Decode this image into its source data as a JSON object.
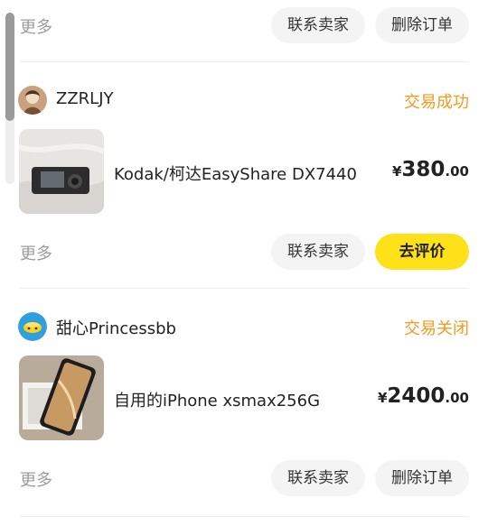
{
  "top_actions": {
    "more_label": "更多",
    "contact_label": "联系卖家",
    "delete_label": "删除订单"
  },
  "orders": [
    {
      "seller_name": "ZZRLJY",
      "status": "交易成功",
      "product_title": "Kodak/柯达EasyShare DX7440",
      "price_currency": "¥",
      "price_integer": "380",
      "price_decimal": ".00",
      "more_label": "更多",
      "contact_label": "联系卖家",
      "action_label": "去评价"
    },
    {
      "seller_name": "甜心Princessbb",
      "status": "交易关闭",
      "product_title": "自用的iPhone xsmax256G",
      "price_currency": "¥",
      "price_integer": "2400",
      "price_decimal": ".00",
      "more_label": "更多",
      "contact_label": "联系卖家",
      "action_label": "删除订单"
    }
  ],
  "colors": {
    "accent_yellow": "#ffe11a",
    "status_orange": "#f39a1e",
    "muted_gray": "#9c9c9c"
  }
}
